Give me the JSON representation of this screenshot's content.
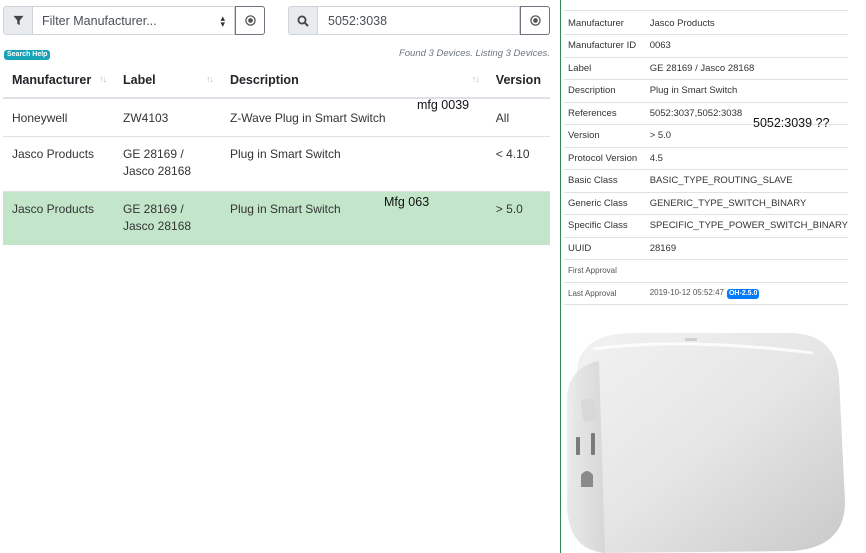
{
  "filter": {
    "placeholder": "Filter Manufacturer...",
    "icon": "filter-icon",
    "clear_icon": "clear-icon"
  },
  "search": {
    "value": "5052:3038",
    "icon": "search-icon",
    "clear_icon": "clear-icon"
  },
  "search_help": "Search Help",
  "found_text": "Found 3 Devices. Listing 3 Devices.",
  "table": {
    "headers": [
      "Manufacturer",
      "Label",
      "Description",
      "Version"
    ],
    "rows": [
      {
        "manufacturer": "Honeywell",
        "label": "ZW4103",
        "description": "Z-Wave Plug in Smart Switch",
        "version": "All",
        "note": "mfg 0039"
      },
      {
        "manufacturer": "Jasco Products",
        "label": "GE 28169 / Jasco 28168",
        "description": "Plug in Smart Switch",
        "version": "< 4.10",
        "note": ""
      },
      {
        "manufacturer": "Jasco Products",
        "label": "GE 28169 / Jasco 28168",
        "description": "Plug in Smart Switch",
        "version": "> 5.0",
        "note": "Mfg 063",
        "selected": true
      }
    ]
  },
  "details": {
    "manufacturer": {
      "key": "Manufacturer",
      "value": "Jasco Products"
    },
    "manufacturer_id": {
      "key": "Manufacturer ID",
      "value": "0063"
    },
    "label": {
      "key": "Label",
      "value": "GE 28169 / Jasco 28168"
    },
    "description": {
      "key": "Description",
      "value": "Plug in Smart Switch"
    },
    "references": {
      "key": "References",
      "value": "5052:3037,5052:3038",
      "note": "5052:3039 ??"
    },
    "version": {
      "key": "Version",
      "value": "> 5.0"
    },
    "protocol_version": {
      "key": "Protocol Version",
      "value": "4.5"
    },
    "basic_class": {
      "key": "Basic Class",
      "value": "BASIC_TYPE_ROUTING_SLAVE"
    },
    "generic_class": {
      "key": "Generic Class",
      "value": "GENERIC_TYPE_SWITCH_BINARY"
    },
    "specific_class": {
      "key": "Specific Class",
      "value": "SPECIFIC_TYPE_POWER_SWITCH_BINARY"
    },
    "uuid": {
      "key": "UUID",
      "value": "28169"
    },
    "first_approval": {
      "key": "First Approval",
      "value": ""
    },
    "last_approval": {
      "key": "Last Approval",
      "value": "2019-10-12 05:52:47",
      "badge": "OH-2.5.0"
    }
  },
  "colors": {
    "selected_row": "#c3e6cb",
    "badge_info": "#17a2b8",
    "badge_primary": "#007bff",
    "divider": "#2e8b57"
  }
}
